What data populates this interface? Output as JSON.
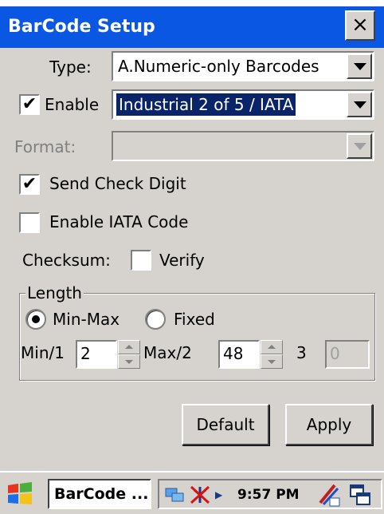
{
  "window": {
    "title": "BarCode Setup",
    "close_glyph": "×"
  },
  "form": {
    "type_label": "Type:",
    "type_value": "A.Numeric-only Barcodes",
    "enable_label": "Enable",
    "enable_checked": "✔",
    "symbology_value": "Industrial 2 of 5 / IATA",
    "format_label": "Format:",
    "format_value": "",
    "send_check_digit_label": "Send Check Digit",
    "send_check_digit_checked": "✔",
    "enable_iata_label": "Enable IATA Code",
    "checksum_label": "Checksum:",
    "verify_label": "Verify"
  },
  "length_group": {
    "title": "Length",
    "minmax_label": "Min-Max",
    "fixed_label": "Fixed",
    "min_label": "Min/1",
    "min_value": "2",
    "max_label": "Max/2",
    "max_value": "48",
    "third_label": "3",
    "third_value": "0"
  },
  "buttons": {
    "default_label": "Default",
    "apply_label": "Apply"
  },
  "taskbar": {
    "task_label": "BarCode ...",
    "clock": "9:57 PM"
  },
  "colors": {
    "title_bar": "#0a57e3",
    "selection": "#0a246a",
    "face": "#d6d3ce"
  }
}
